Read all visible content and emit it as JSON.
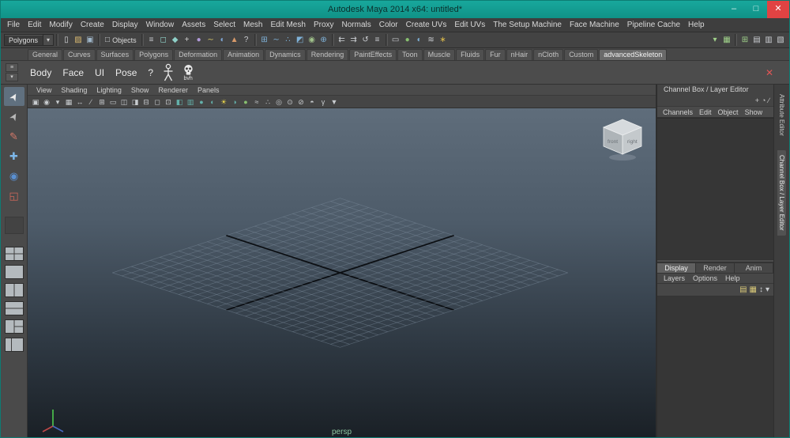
{
  "window": {
    "title": "Autodesk Maya 2014 x64: untitled*",
    "controls": {
      "minimize": "–",
      "maximize": "□",
      "close": "✕"
    }
  },
  "colors": {
    "titlebar_teal": "#14a096",
    "close_red": "#e04343",
    "ui_gray": "#444444",
    "viewport_bg_top": "#5f6d7b",
    "viewport_bg_bottom": "#1a2026"
  },
  "menu_bar": {
    "items": [
      "File",
      "Edit",
      "Modify",
      "Create",
      "Display",
      "Window",
      "Assets",
      "Select",
      "Mesh",
      "Edit Mesh",
      "Proxy",
      "Normals",
      "Color",
      "Create UVs",
      "Edit UVs",
      "The Setup Machine",
      "Face Machine",
      "Pipeline Cache",
      "Help"
    ]
  },
  "status_line": {
    "menu_set": "Polygons",
    "dropdown_arrow": "▾",
    "scene_icons": [
      {
        "name": "new-scene-icon",
        "glyph": "▯",
        "color": "#d8dadc"
      },
      {
        "name": "open-scene-icon",
        "glyph": "▨",
        "color": "#d8b871"
      },
      {
        "name": "save-scene-icon",
        "glyph": "▣",
        "color": "#9fb6c9"
      }
    ],
    "selection_mode": {
      "icon": "□",
      "label": "Objects"
    },
    "mask_icons": [
      {
        "name": "select-by-hierarchy-icon",
        "glyph": "≡",
        "color": "#c9ccd0"
      },
      {
        "name": "select-by-object-icon",
        "glyph": "◻",
        "color": "#8fd0c8"
      },
      {
        "name": "select-by-component-icon",
        "glyph": "◆",
        "color": "#8fd0c8"
      },
      {
        "name": "mask-handles-icon",
        "glyph": "+",
        "color": "#d0d0d0"
      },
      {
        "name": "mask-joints-icon",
        "glyph": "●",
        "color": "#b09ad8"
      },
      {
        "name": "mask-curves-icon",
        "glyph": "∼",
        "color": "#d8c86a"
      },
      {
        "name": "mask-surfaces-icon",
        "glyph": "◐",
        "color": "#7fa8d8"
      },
      {
        "name": "mask-deformers-icon",
        "glyph": "▲",
        "color": "#d89a6a"
      },
      {
        "name": "mask-misc-icon",
        "glyph": "?",
        "color": "#c9ccd0"
      }
    ],
    "snap_icons": [
      {
        "name": "snap-to-grids-icon",
        "glyph": "⊞",
        "color": "#7fb2d8"
      },
      {
        "name": "snap-to-curves-icon",
        "glyph": "∼",
        "color": "#7fb2d8"
      },
      {
        "name": "snap-to-points-icon",
        "glyph": "∴",
        "color": "#7fb2d8"
      },
      {
        "name": "snap-to-planes-icon",
        "glyph": "◩",
        "color": "#7fb2d8"
      },
      {
        "name": "make-live-icon",
        "glyph": "◉",
        "color": "#9fc08a"
      },
      {
        "name": "snap-align-icon",
        "glyph": "⊕",
        "color": "#7fb2d8"
      }
    ],
    "history_icons": [
      {
        "name": "input-connections-icon",
        "glyph": "⇇",
        "color": "#c9ccd0"
      },
      {
        "name": "output-connections-icon",
        "glyph": "⇉",
        "color": "#c9ccd0"
      },
      {
        "name": "construction-history-icon",
        "glyph": "↺",
        "color": "#c9ccd0"
      },
      {
        "name": "list-history-icon",
        "glyph": "≡",
        "color": "#c9ccd0"
      }
    ],
    "render_icons": [
      {
        "name": "open-render-view-icon",
        "glyph": "▭",
        "color": "#c9ccd0"
      },
      {
        "name": "render-current-frame-icon",
        "glyph": "●",
        "color": "#88c070"
      },
      {
        "name": "ipr-render-icon",
        "glyph": "◐",
        "color": "#7fb2d8"
      },
      {
        "name": "render-settings-icon",
        "glyph": "≋",
        "color": "#c9ccd0"
      },
      {
        "name": "paint-effects-icon",
        "glyph": "∗",
        "color": "#d8b84a"
      }
    ],
    "right_toggle_icons_a": [
      {
        "name": "toggle-panel-menus-icon",
        "glyph": "▾",
        "color": "#9fd08a"
      },
      {
        "name": "toggle-shelf-icon",
        "glyph": "▦",
        "color": "#9fd08a"
      }
    ],
    "right_toggle_icons_b": [
      {
        "name": "show-grid-toggle-icon",
        "glyph": "⊞",
        "color": "#9fd08a"
      },
      {
        "name": "show-ui-elements-icon",
        "glyph": "▤",
        "color": "#c9ccd0"
      },
      {
        "name": "hotbox-controls-icon",
        "glyph": "▥",
        "color": "#c9ccd0"
      },
      {
        "name": "sidebar-toggle-icon",
        "glyph": "▧",
        "color": "#c9ccd0"
      }
    ]
  },
  "shelf": {
    "arrow_buttons": [
      "≡",
      "▾"
    ],
    "tabs": [
      {
        "label": "General"
      },
      {
        "label": "Curves"
      },
      {
        "label": "Surfaces"
      },
      {
        "label": "Polygons"
      },
      {
        "label": "Deformation"
      },
      {
        "label": "Animation"
      },
      {
        "label": "Dynamics"
      },
      {
        "label": "Rendering"
      },
      {
        "label": "PaintEffects"
      },
      {
        "label": "Toon"
      },
      {
        "label": "Muscle"
      },
      {
        "label": "Fluids"
      },
      {
        "label": "Fur"
      },
      {
        "label": "nHair"
      },
      {
        "label": "nCloth"
      },
      {
        "label": "Custom"
      },
      {
        "label": "advancedSkeleton",
        "active": true
      }
    ],
    "text_buttons": [
      "Body",
      "Face",
      "UI",
      "Pose",
      "?"
    ],
    "bvh_label": "bvh",
    "close_glyph": "✕"
  },
  "toolbox": {
    "tools": [
      {
        "name": "select-tool-button",
        "glyph": "➤",
        "color": "#eaeaea"
      },
      {
        "name": "lasso-tool-button",
        "glyph": "➤",
        "color": "#b8b8b8"
      },
      {
        "name": "paint-select-tool-button",
        "glyph": "✎",
        "color": "#d87a6a"
      },
      {
        "name": "move-tool-button",
        "glyph": "✚",
        "color": "#7db7e8"
      },
      {
        "name": "rotate-tool-button",
        "glyph": "◉",
        "color": "#5a8fd0"
      },
      {
        "name": "scale-tool-button",
        "glyph": "◱",
        "color": "#d0685a"
      }
    ],
    "layouts": [
      {
        "name": "layout-four-pane-button",
        "pattern": "quad"
      },
      {
        "name": "layout-single-pane-button",
        "pattern": "single"
      },
      {
        "name": "layout-two-pane-side-button",
        "pattern": "split-v"
      },
      {
        "name": "layout-two-pane-stacked-button",
        "pattern": "split-h"
      },
      {
        "name": "layout-three-pane-button",
        "pattern": "three-left"
      },
      {
        "name": "layout-outliner-persp-button",
        "pattern": "split-third"
      }
    ]
  },
  "viewport": {
    "menus": [
      "View",
      "Shading",
      "Lighting",
      "Show",
      "Renderer",
      "Panels"
    ],
    "icons": [
      {
        "name": "select-camera-icon",
        "glyph": "▣",
        "color": "#c8cccf"
      },
      {
        "name": "camera-attributes-icon",
        "glyph": "◉",
        "color": "#c8cccf"
      },
      {
        "name": "bookmarks-icon",
        "glyph": "▾",
        "color": "#c8cccf"
      },
      {
        "name": "image-plane-icon",
        "glyph": "▦",
        "color": "#c8cccf"
      },
      {
        "name": "two-d-pan-zoom-icon",
        "glyph": "↔",
        "color": "#c8cccf"
      },
      {
        "name": "grease-pencil-icon",
        "glyph": "∕",
        "color": "#c8cccf"
      },
      {
        "name": "grid-toggle-icon",
        "glyph": "⊞",
        "color": "#c8cccf"
      },
      {
        "name": "film-gate-icon",
        "glyph": "▭",
        "color": "#c8cccf"
      },
      {
        "name": "resolution-gate-icon",
        "glyph": "◫",
        "color": "#c8cccf"
      },
      {
        "name": "gate-mask-icon",
        "glyph": "◨",
        "color": "#c8cccf"
      },
      {
        "name": "field-chart-icon",
        "glyph": "⊟",
        "color": "#c8cccf"
      },
      {
        "name": "safe-action-icon",
        "glyph": "◻",
        "color": "#c8cccf"
      },
      {
        "name": "safe-title-icon",
        "glyph": "⊡",
        "color": "#c8cccf"
      },
      {
        "name": "fill-mode-icon",
        "glyph": "◧",
        "color": "#63b0aa"
      },
      {
        "name": "wireframe-icon",
        "glyph": "▥",
        "color": "#63b0aa"
      },
      {
        "name": "shaded-mode-icon",
        "glyph": "●",
        "color": "#63b0aa"
      },
      {
        "name": "textured-mode-icon",
        "glyph": "◐",
        "color": "#63b0aa"
      },
      {
        "name": "use-all-lights-icon",
        "glyph": "☀",
        "color": "#e8d44a"
      },
      {
        "name": "shadows-icon",
        "glyph": "◑",
        "color": "#63b0aa"
      },
      {
        "name": "ambient-occlusion-icon",
        "glyph": "●",
        "color": "#88c070"
      },
      {
        "name": "motion-blur-icon",
        "glyph": "≈",
        "color": "#c8cccf"
      },
      {
        "name": "multisample-icon",
        "glyph": "∴",
        "color": "#c8cccf"
      },
      {
        "name": "depth-of-field-icon",
        "glyph": "◎",
        "color": "#c8cccf"
      },
      {
        "name": "isolate-select-icon",
        "glyph": "⊙",
        "color": "#c8cccf"
      },
      {
        "name": "xray-icon",
        "glyph": "⊘",
        "color": "#c8cccf"
      },
      {
        "name": "exposure-icon",
        "glyph": "◓",
        "color": "#c8cccf"
      },
      {
        "name": "gamma-icon",
        "glyph": "γ",
        "color": "#c8cccf"
      },
      {
        "name": "viewport-renderer-icon",
        "glyph": "▼",
        "color": "#c8cccf"
      }
    ],
    "camera_label": "persp",
    "view_cube": {
      "faces": [
        "front",
        "right"
      ]
    },
    "canvas_colors": {
      "grid": "#7b8b9b",
      "axis": "#0b0e12"
    }
  },
  "channel_box": {
    "title": "Channel Box / Layer Editor",
    "mini_icons": [
      {
        "name": "channel-manip-icon",
        "glyph": "+"
      },
      {
        "name": "channel-speed-icon",
        "glyph": "◔"
      },
      {
        "name": "channel-edit-icon",
        "glyph": "∕"
      }
    ],
    "menus": [
      "Channels",
      "Edit",
      "Object",
      "Show"
    ]
  },
  "layer_editor": {
    "tabs": [
      {
        "label": "Display",
        "active": true
      },
      {
        "label": "Render"
      },
      {
        "label": "Anim"
      }
    ],
    "menus": [
      "Layers",
      "Options",
      "Help"
    ],
    "icons": [
      {
        "name": "new-empty-layer-icon",
        "glyph": "▤",
        "color": "#d8c878"
      },
      {
        "name": "new-layer-from-selected-icon",
        "glyph": "▦",
        "color": "#d8c878"
      },
      {
        "name": "sort-layers-icon",
        "glyph": "↕",
        "color": "#c9ccd0"
      },
      {
        "name": "layer-menu-icon",
        "glyph": "▾",
        "color": "#c9ccd0"
      }
    ]
  },
  "side_tabs": [
    {
      "label": "Attribute Editor"
    },
    {
      "label": "Channel Box / Layer Editor",
      "active": true
    }
  ]
}
